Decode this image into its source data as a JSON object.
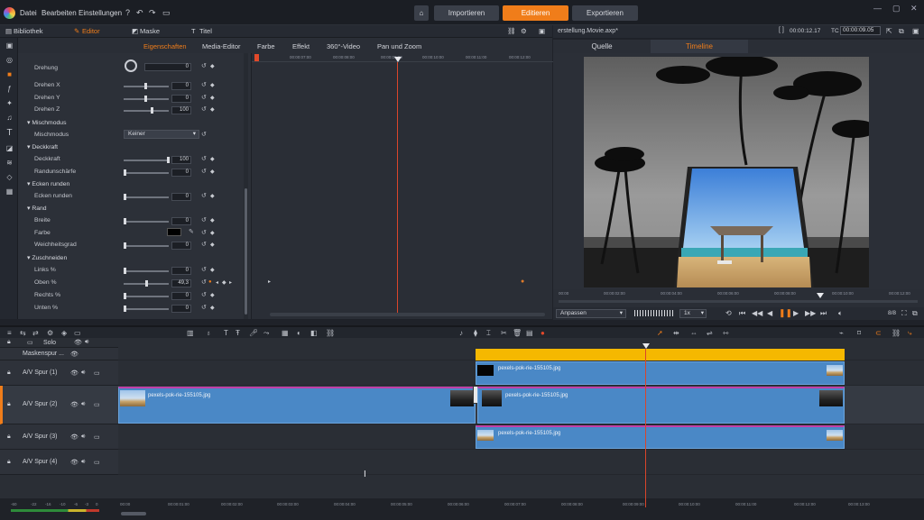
{
  "menu": {
    "items": [
      "Datei",
      "Bearbeiten",
      "Einstellungen"
    ],
    "help_icon": "help-icon",
    "undo_icon": "undo-icon",
    "redo_icon": "redo-icon",
    "doc_icon": "document-icon"
  },
  "nav": {
    "home_icon": "home-icon",
    "import_label": "Importieren",
    "edit_label": "Editieren",
    "export_label": "Exportieren"
  },
  "left_tabs": {
    "library": "Bibliothek",
    "editor": "Editor",
    "mask": "Maske",
    "title": "Titel"
  },
  "sub_tabs": [
    "Eigenschaften",
    "Media-Editor",
    "Farbe",
    "Effekt",
    "360°-Video",
    "Pan und Zoom"
  ],
  "properties": {
    "drehung_label": "Drehung",
    "drehung_value": "0",
    "drehen_x_label": "Drehen X",
    "drehen_x_value": "0",
    "drehen_y_label": "Drehen Y",
    "drehen_y_value": "0",
    "drehen_z_label": "Drehen Z",
    "drehen_z_value": "100",
    "mischmodus_section": "Mischmodus",
    "mischmodus_label": "Mischmodus",
    "mischmodus_value": "Keiner",
    "deckkraft_section": "Deckkraft",
    "deckkraft_label": "Deckkraft",
    "deckkraft_value": "100",
    "randunschaerfe_label": "Randunschärfe",
    "randunschaerfe_value": "0",
    "ecken_section": "Ecken runden",
    "ecken_label": "Ecken runden",
    "ecken_value": "0",
    "rand_section": "Rand",
    "breite_label": "Breite",
    "breite_value": "0",
    "farbe_label": "Farbe",
    "weichheit_label": "Weichheitsgrad",
    "weichheit_value": "0",
    "zuschneiden_section": "Zuschneiden",
    "links_label": "Links %",
    "links_value": "0",
    "oben_label": "Oben %",
    "oben_value": "49,3",
    "rechts_label": "Rechts %",
    "rechts_value": "0",
    "unten_label": "Unten %",
    "unten_value": "0"
  },
  "prop_ruler": [
    "00:00:07:00",
    "00:00:08:00",
    "00:00:09:00",
    "00:00:10:00",
    "00:00:11:00",
    "00:00:12:00"
  ],
  "preview": {
    "filename": "erstellung.Movie.axp*",
    "duration": "00:00:12.17",
    "tc_label": "TC",
    "timecode": "00:00:09.05",
    "tab_source": "Quelle",
    "tab_timeline": "Timeline",
    "ruler": [
      "00:00",
      "00:00:02:00",
      "00:00:04:00",
      "00:00:06:00",
      "00:00:08:00",
      "00:00:10:00",
      "00:00:12:00"
    ],
    "fit_label": "Anpassen",
    "speed_label": "1x",
    "ratio_label": "8/8"
  },
  "tracks": {
    "solo_label": "Solo",
    "mask_track": "Maskenspur ...",
    "track1": "A/V Spur (1)",
    "track2": "A/V Spur (2)",
    "track3": "A/V Spur (3)",
    "track4": "A/V Spur (4)",
    "clip_name": "pexels-pok-rie-155105.jpg"
  },
  "tl_ruler": [
    "00:00",
    "00:00:01:00",
    "00:00:02:00",
    "00:00:03:00",
    "00:00:04:00",
    "00:00:05:00",
    "00:00:06:00",
    "00:00:07:00",
    "00:00:08:00",
    "00:00:09:00",
    "00:00:10:00",
    "00:00:11:00",
    "00:00:12:00",
    "00:00:13:00"
  ],
  "meter_labels": [
    "-60",
    "-22",
    "-16",
    "-10",
    "-6",
    "-3",
    "0"
  ],
  "colors": {
    "accent": "#f07d1a",
    "clip_blue": "#4a88c6",
    "mask_yellow": "#f5b800",
    "playhead": "#d9452b",
    "selection_magenta": "#c23fa7"
  }
}
